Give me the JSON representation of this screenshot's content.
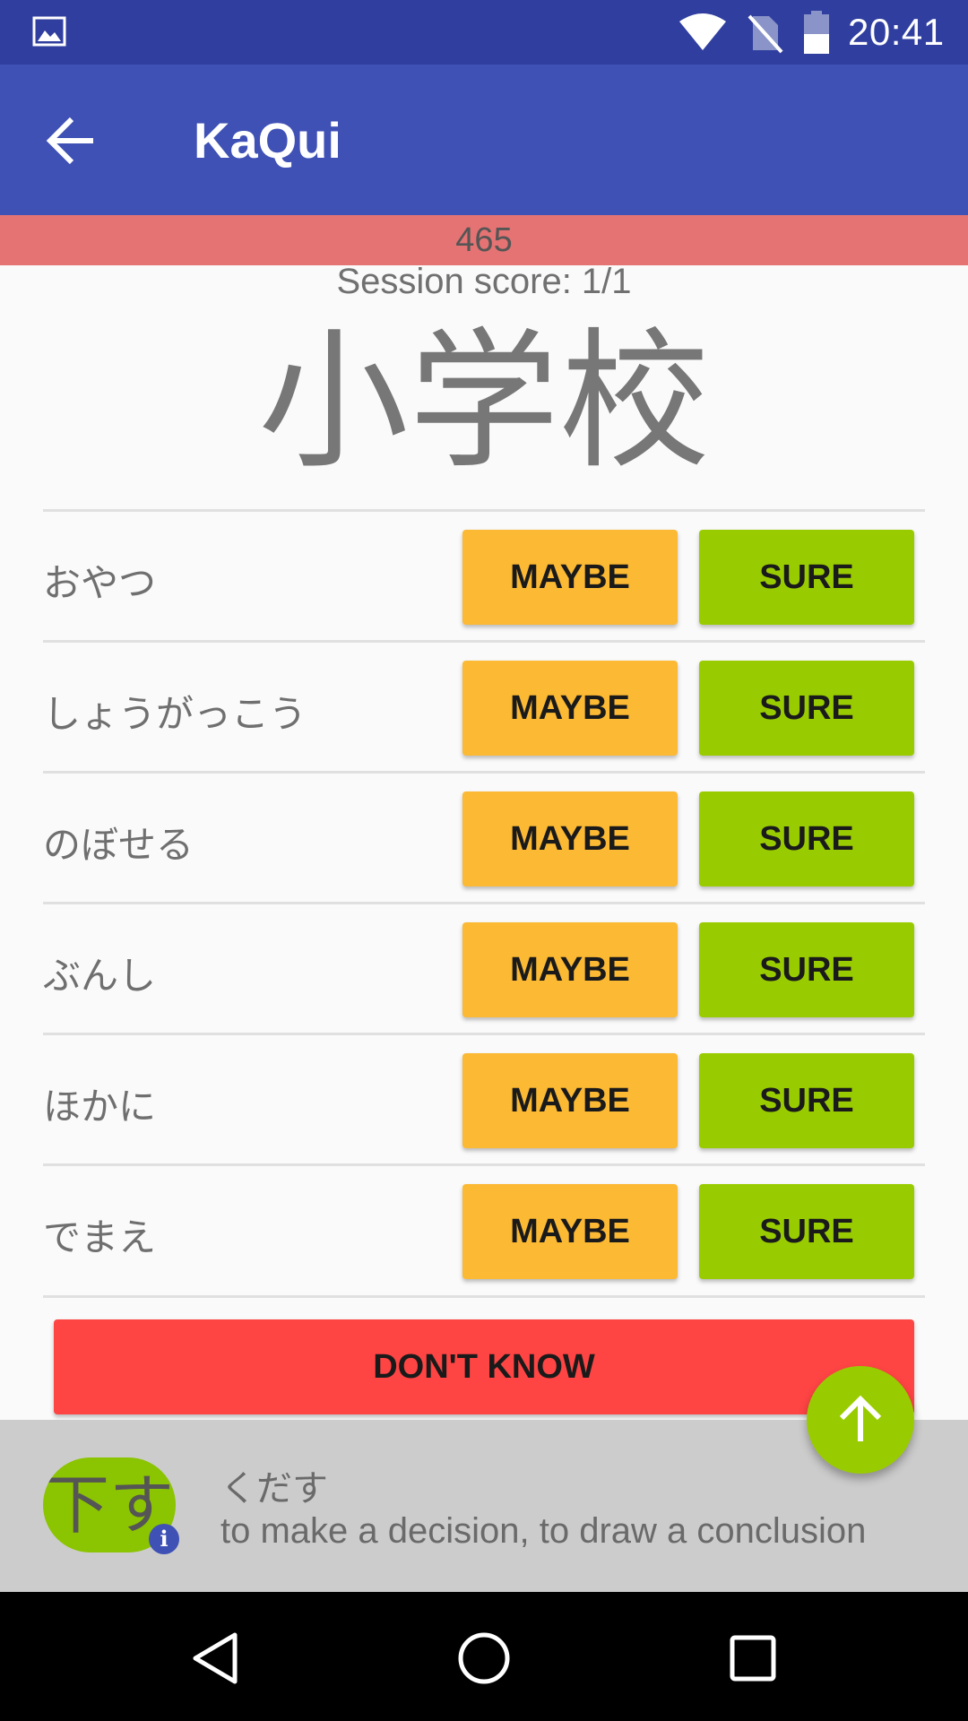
{
  "status_bar": {
    "time": "20:41",
    "icons": [
      "gallery-icon",
      "wifi-icon",
      "no-sim-icon",
      "battery-icon"
    ]
  },
  "app_bar": {
    "title": "KaQui",
    "back_icon": "arrow-left-icon"
  },
  "score_bar": {
    "value": "465"
  },
  "session_score": "Session score: 1/1",
  "question": {
    "kanji": "小学校"
  },
  "answers": [
    {
      "reading": "おやつ",
      "maybe_label": "MAYBE",
      "sure_label": "SURE"
    },
    {
      "reading": "しょうがっこう",
      "maybe_label": "MAYBE",
      "sure_label": "SURE"
    },
    {
      "reading": "のぼせる",
      "maybe_label": "MAYBE",
      "sure_label": "SURE"
    },
    {
      "reading": "ぶんし",
      "maybe_label": "MAYBE",
      "sure_label": "SURE"
    },
    {
      "reading": "ほかに",
      "maybe_label": "MAYBE",
      "sure_label": "SURE"
    },
    {
      "reading": "でまえ",
      "maybe_label": "MAYBE",
      "sure_label": "SURE"
    }
  ],
  "dont_know_label": "DON'T KNOW",
  "last_item": {
    "kanji": "下す",
    "reading": "くだす",
    "meaning": "to make a decision, to draw a conclusion",
    "info_icon": "info-icon"
  },
  "fab_icon": "arrow-up-icon",
  "nav_bar": {
    "icons": [
      "nav-back-icon",
      "nav-home-icon",
      "nav-recents-icon"
    ]
  },
  "colors": {
    "status_bar": "#303f9f",
    "app_bar": "#3f51b5",
    "score_bar": "#e57373",
    "maybe": "#fbb934",
    "sure": "#99cc00",
    "dont_know": "#ff4444",
    "panel": "#cccccc"
  }
}
